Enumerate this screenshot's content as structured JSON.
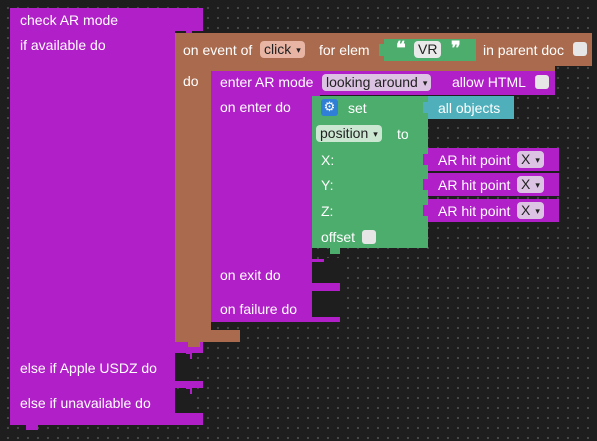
{
  "colors": {
    "ar_block": "#b01fc7",
    "event_block": "#a96a4d",
    "set_block": "#4dad6d",
    "objects_block": "#4fb0bb",
    "field_bg": "#e9e9e9",
    "canvas": "#1e1e1e"
  },
  "check_ar": {
    "title": "check AR mode",
    "if_available": "if available do",
    "else_usdz": "else if Apple USDZ do",
    "else_unavailable": "else if unavailable do"
  },
  "event": {
    "prefix": "on event of",
    "event_value": "click",
    "for_elem": "for elem",
    "elem_text": "VR",
    "in_parent_doc": "in parent doc",
    "do_label": "do"
  },
  "enter_ar": {
    "label": "enter AR mode",
    "mode_value": "looking around",
    "allow_html": "allow HTML",
    "on_enter": "on enter do",
    "on_exit": "on exit do",
    "on_failure": "on failure do"
  },
  "set_block": {
    "set_label": "set",
    "target": "all objects",
    "property_value": "position",
    "to_label": "to",
    "x_label": "X:",
    "y_label": "Y:",
    "z_label": "Z:",
    "offset_label": "offset"
  },
  "hit_points": [
    {
      "label": "AR hit point",
      "axis": "X"
    },
    {
      "label": "AR hit point",
      "axis": "X"
    },
    {
      "label": "AR hit point",
      "axis": "X"
    }
  ],
  "icons": {
    "gear": "gear-icon",
    "dropdown": "dropdown-arrow-icon",
    "quote_open": "open-quote-icon",
    "quote_close": "close-quote-icon"
  },
  "glyphs": {
    "arrow": "▾",
    "gear": "⚙",
    "quote_open": "❝",
    "quote_close": "❞"
  }
}
